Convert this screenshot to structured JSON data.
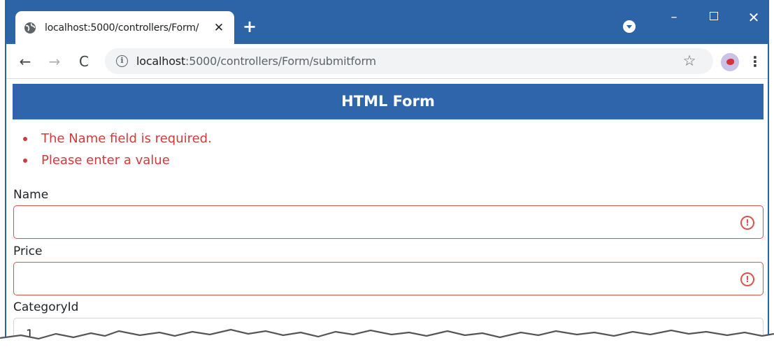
{
  "browser": {
    "tab_title": "localhost:5000/controllers/Form/",
    "tab_close": "✕",
    "new_tab": "+",
    "url_host": "localhost",
    "url_path": ":5000/controllers/Form/submitform",
    "window_minimize": "–",
    "window_close": "✕",
    "info_symbol": "i",
    "back_symbol": "←",
    "forward_symbol": "→",
    "reload_symbol": "C",
    "star_symbol": "☆",
    "menu_symbol": "⋮"
  },
  "page": {
    "header": "HTML Form",
    "errors": [
      "The Name field is required.",
      "Please enter a value"
    ],
    "fields": [
      {
        "label": "Name",
        "value": "",
        "invalid": true
      },
      {
        "label": "Price",
        "value": "",
        "invalid": true
      },
      {
        "label": "CategoryId",
        "value": "1",
        "invalid": false
      }
    ],
    "warn_symbol": "!"
  },
  "colors": {
    "titlebar": "#2d63a7",
    "header": "#2f65aa",
    "error": "#d13a3a",
    "invalid_border": "#d9534f"
  },
  "icons": [
    "globe-icon",
    "close-icon",
    "plus-icon",
    "info-icon",
    "star-icon",
    "kebab-menu-icon",
    "warning-icon"
  ]
}
